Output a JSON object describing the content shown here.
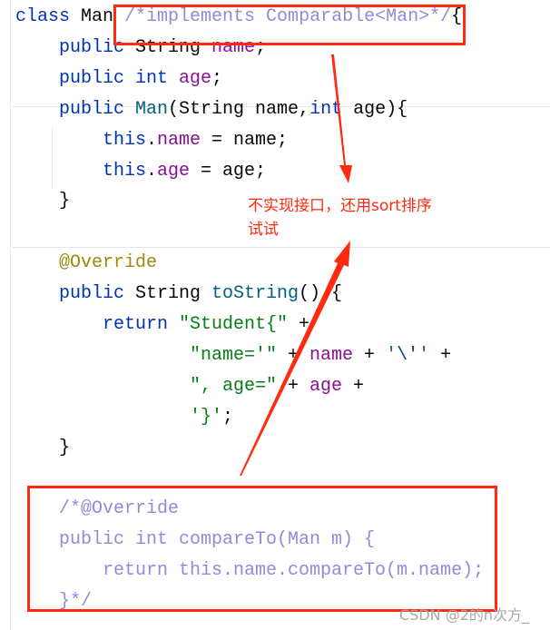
{
  "code_lines": [
    {
      "top": 0,
      "indent": 0,
      "tokens": [
        [
          "class ",
          "kw"
        ],
        [
          "Man ",
          "plain"
        ],
        [
          "/*implements Comparable<Man>*/",
          "cm"
        ],
        [
          "{",
          "plain"
        ]
      ]
    },
    {
      "indent": 4,
      "tokens": [
        [
          "public ",
          "kw"
        ],
        [
          "String ",
          "plain"
        ],
        [
          "name",
          "field"
        ],
        [
          ";",
          "plain"
        ]
      ]
    },
    {
      "indent": 4,
      "tokens": [
        [
          "public ",
          "kw"
        ],
        [
          "int ",
          "kw"
        ],
        [
          "age",
          "field"
        ],
        [
          ";",
          "plain"
        ]
      ]
    },
    {
      "indent": 4,
      "tokens": [
        [
          "public ",
          "kw"
        ],
        [
          "Man",
          "fn"
        ],
        [
          "(String name,",
          "plain"
        ],
        [
          "int ",
          "kw"
        ],
        [
          "age){",
          "plain"
        ]
      ]
    },
    {
      "indent": 8,
      "tokens": [
        [
          "this",
          "kw"
        ],
        [
          ".",
          "plain"
        ],
        [
          "name",
          "field"
        ],
        [
          " = name;",
          "plain"
        ]
      ]
    },
    {
      "indent": 8,
      "tokens": [
        [
          "this",
          "kw"
        ],
        [
          ".",
          "plain"
        ],
        [
          "age",
          "field"
        ],
        [
          " = age;",
          "plain"
        ]
      ]
    },
    {
      "indent": 4,
      "tokens": [
        [
          "}",
          "plain"
        ]
      ]
    },
    {
      "indent": 0,
      "tokens": []
    },
    {
      "indent": 4,
      "tokens": [
        [
          "@Override",
          "ann"
        ]
      ]
    },
    {
      "indent": 4,
      "tokens": [
        [
          "public ",
          "kw"
        ],
        [
          "String ",
          "plain"
        ],
        [
          "toString",
          "fn"
        ],
        [
          "() {",
          "plain"
        ]
      ]
    },
    {
      "indent": 8,
      "tokens": [
        [
          "return ",
          "kw"
        ],
        [
          "\"Student{\"",
          "str"
        ],
        [
          " +",
          "plain"
        ]
      ]
    },
    {
      "indent": 16,
      "tokens": [
        [
          "\"name='\"",
          "str"
        ],
        [
          " + ",
          "plain"
        ],
        [
          "name",
          "field"
        ],
        [
          " + ",
          "plain"
        ],
        [
          "'",
          "str"
        ],
        [
          "\\'",
          "esc"
        ],
        [
          "'",
          "str"
        ],
        [
          " +",
          "plain"
        ]
      ]
    },
    {
      "indent": 16,
      "tokens": [
        [
          "\", age=\"",
          "str"
        ],
        [
          " + ",
          "plain"
        ],
        [
          "age",
          "field"
        ],
        [
          " +",
          "plain"
        ]
      ]
    },
    {
      "indent": 16,
      "tokens": [
        [
          "'}'",
          "str"
        ],
        [
          ";",
          "plain"
        ]
      ]
    },
    {
      "indent": 4,
      "tokens": [
        [
          "}",
          "plain"
        ]
      ]
    },
    {
      "indent": 0,
      "tokens": []
    },
    {
      "indent": 4,
      "tokens": [
        [
          "/*@Override",
          "cm"
        ]
      ]
    },
    {
      "indent": 4,
      "tokens": [
        [
          "public int compareTo(Man m) {",
          "cm"
        ]
      ]
    },
    {
      "indent": 8,
      "tokens": [
        [
          "return this.name.compareTo(m.name);",
          "cm"
        ]
      ]
    },
    {
      "indent": 4,
      "tokens": [
        [
          "}*/",
          "cm"
        ]
      ]
    }
  ],
  "annotation": {
    "note_line1": "不实现接口，还用sort排序",
    "note_line2": "试试",
    "color": "#ff2a10"
  },
  "watermark": "CSDN @2的n次方_",
  "colors": {
    "keyword": "#0033b3",
    "field": "#871094",
    "string": "#067d17",
    "annotation": "#9e880d",
    "method": "#00627a",
    "comment": "#8c8cdb"
  }
}
